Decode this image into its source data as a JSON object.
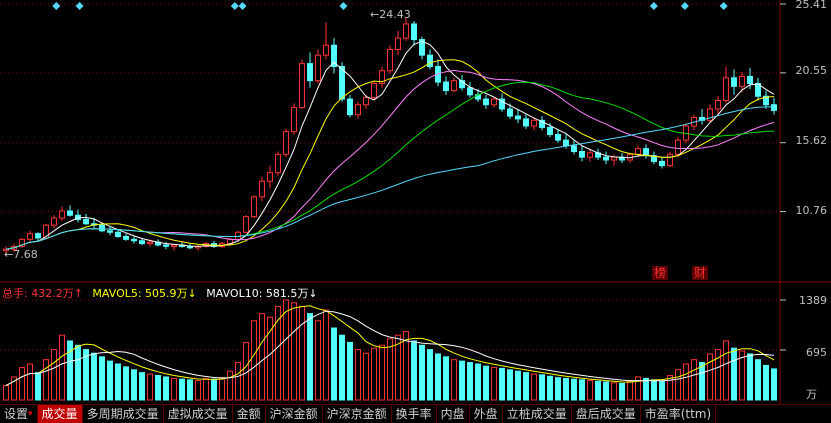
{
  "price_axis": [
    "25.41",
    "20.55",
    "15.62",
    "10.76"
  ],
  "volume_axis": [
    "1389",
    "695"
  ],
  "volume_unit": "万",
  "peak_label": "24.43",
  "low_label": "7.68",
  "volume_info": {
    "total": "总手: 432.2万↑",
    "mavol5": "MAVOL5: 505.9万↓",
    "mavol10": "MAVOL10: 581.5万↓"
  },
  "markers": [
    "榜",
    "财"
  ],
  "tabs": [
    "设置",
    "成交量",
    "多周期成交量",
    "虚拟成交量",
    "金额",
    "沪深金额",
    "沪深京金额",
    "换手率",
    "内盘",
    "外盘",
    "立桩成交量",
    "盘后成交量",
    "市盈率(ttm)"
  ],
  "active_tab": "成交量",
  "colors": {
    "up": "#ff3232",
    "down": "#54ffff",
    "ma5": "#ffffff",
    "ma10": "#ffff00",
    "ma20": "#ff80ff",
    "ma30": "#00e000",
    "ma60": "#54d8ff",
    "grid": "#800000"
  },
  "chart_data": {
    "type": "candlestick",
    "price_range": [
      7.2,
      25.41
    ],
    "volume_range": [
      0,
      1389
    ],
    "candles": [
      [
        8.0,
        8.3,
        7.7,
        8.1,
        200
      ],
      [
        8.1,
        8.5,
        7.9,
        8.3,
        320
      ],
      [
        8.3,
        8.9,
        8.2,
        8.8,
        450
      ],
      [
        8.8,
        9.4,
        8.6,
        9.2,
        500
      ],
      [
        9.2,
        9.3,
        8.7,
        8.9,
        380
      ],
      [
        8.9,
        9.9,
        8.8,
        9.8,
        560
      ],
      [
        9.8,
        10.5,
        9.6,
        10.3,
        700
      ],
      [
        10.3,
        11.1,
        10.1,
        10.8,
        900
      ],
      [
        10.8,
        11.2,
        10.4,
        10.5,
        820
      ],
      [
        10.5,
        10.9,
        10.0,
        10.2,
        760
      ],
      [
        10.2,
        10.6,
        9.8,
        9.9,
        700
      ],
      [
        9.9,
        10.3,
        9.6,
        9.8,
        650
      ],
      [
        9.8,
        10.0,
        9.3,
        9.4,
        600
      ],
      [
        9.4,
        9.7,
        9.1,
        9.3,
        540
      ],
      [
        9.3,
        9.5,
        8.9,
        9.0,
        500
      ],
      [
        9.0,
        9.2,
        8.7,
        8.8,
        460
      ],
      [
        8.8,
        9.0,
        8.5,
        8.7,
        420
      ],
      [
        8.7,
        8.9,
        8.4,
        8.5,
        380
      ],
      [
        8.5,
        8.8,
        8.3,
        8.6,
        360
      ],
      [
        8.6,
        8.8,
        8.3,
        8.4,
        340
      ],
      [
        8.4,
        8.6,
        8.1,
        8.3,
        320
      ],
      [
        8.3,
        8.5,
        8.0,
        8.4,
        300
      ],
      [
        8.4,
        8.6,
        8.2,
        8.3,
        290
      ],
      [
        8.3,
        8.5,
        8.1,
        8.2,
        280
      ],
      [
        8.2,
        8.4,
        8.0,
        8.3,
        270
      ],
      [
        8.3,
        8.6,
        8.2,
        8.5,
        300
      ],
      [
        8.5,
        8.7,
        8.2,
        8.3,
        290
      ],
      [
        8.3,
        8.6,
        8.2,
        8.5,
        310
      ],
      [
        8.5,
        8.9,
        8.4,
        8.8,
        400
      ],
      [
        8.8,
        9.4,
        8.7,
        9.3,
        520
      ],
      [
        9.3,
        10.5,
        9.2,
        10.4,
        800
      ],
      [
        10.4,
        11.9,
        10.3,
        11.8,
        1100
      ],
      [
        11.8,
        13.2,
        11.5,
        12.9,
        1200
      ],
      [
        12.9,
        14.0,
        12.4,
        13.5,
        1150
      ],
      [
        13.5,
        15.0,
        13.3,
        14.8,
        1300
      ],
      [
        14.8,
        16.6,
        14.6,
        16.4,
        1389
      ],
      [
        16.4,
        18.4,
        16.2,
        18.1,
        1350
      ],
      [
        18.1,
        21.5,
        18.0,
        21.2,
        1300
      ],
      [
        21.2,
        22.0,
        19.5,
        20.0,
        1200
      ],
      [
        20.0,
        22.2,
        19.8,
        21.8,
        1100
      ],
      [
        21.8,
        24.1,
        21.5,
        22.5,
        1250
      ],
      [
        22.5,
        23.0,
        20.5,
        21.0,
        1000
      ],
      [
        21.0,
        21.3,
        18.5,
        18.7,
        900
      ],
      [
        18.7,
        19.0,
        17.4,
        17.6,
        800
      ],
      [
        17.6,
        18.5,
        17.3,
        18.3,
        700
      ],
      [
        18.3,
        19.0,
        18.0,
        18.8,
        650
      ],
      [
        18.8,
        20.0,
        18.6,
        19.8,
        720
      ],
      [
        19.8,
        21.0,
        19.5,
        20.7,
        760
      ],
      [
        20.7,
        22.5,
        20.5,
        22.2,
        850
      ],
      [
        22.2,
        23.5,
        21.8,
        23.0,
        900
      ],
      [
        23.0,
        24.43,
        22.8,
        24.0,
        950
      ],
      [
        24.0,
        24.2,
        22.5,
        22.9,
        820
      ],
      [
        22.9,
        23.1,
        21.5,
        21.8,
        760
      ],
      [
        21.8,
        22.2,
        20.8,
        21.0,
        700
      ],
      [
        21.0,
        21.5,
        19.6,
        19.9,
        640
      ],
      [
        19.9,
        20.3,
        19.0,
        19.3,
        600
      ],
      [
        19.3,
        20.2,
        19.2,
        20.0,
        560
      ],
      [
        20.0,
        20.4,
        19.3,
        19.5,
        540
      ],
      [
        19.5,
        19.9,
        18.8,
        19.0,
        520
      ],
      [
        19.0,
        19.4,
        18.5,
        18.7,
        500
      ],
      [
        18.7,
        19.0,
        18.0,
        18.3,
        470
      ],
      [
        18.3,
        18.9,
        18.1,
        18.7,
        450
      ],
      [
        18.7,
        19.1,
        17.8,
        18.0,
        440
      ],
      [
        18.0,
        18.4,
        17.3,
        17.5,
        420
      ],
      [
        17.5,
        18.0,
        17.0,
        17.3,
        400
      ],
      [
        17.3,
        17.6,
        16.6,
        16.8,
        380
      ],
      [
        16.8,
        17.4,
        16.5,
        17.2,
        360
      ],
      [
        17.2,
        17.5,
        16.5,
        16.7,
        350
      ],
      [
        16.7,
        17.0,
        16.0,
        16.2,
        330
      ],
      [
        16.2,
        16.6,
        15.6,
        15.8,
        310
      ],
      [
        15.8,
        16.2,
        15.2,
        15.4,
        300
      ],
      [
        15.4,
        15.8,
        14.8,
        15.0,
        290
      ],
      [
        15.0,
        15.4,
        14.3,
        14.6,
        280
      ],
      [
        14.6,
        15.2,
        14.3,
        14.9,
        270
      ],
      [
        14.9,
        15.2,
        14.4,
        14.6,
        260
      ],
      [
        14.6,
        15.0,
        14.1,
        14.4,
        250
      ],
      [
        14.4,
        14.8,
        14.0,
        14.6,
        240
      ],
      [
        14.6,
        14.9,
        14.2,
        14.4,
        230
      ],
      [
        14.4,
        14.9,
        14.2,
        14.8,
        260
      ],
      [
        14.8,
        15.4,
        14.6,
        15.2,
        320
      ],
      [
        15.2,
        15.5,
        14.5,
        14.7,
        300
      ],
      [
        14.7,
        15.0,
        14.1,
        14.3,
        280
      ],
      [
        14.3,
        14.6,
        13.8,
        14.0,
        260
      ],
      [
        14.0,
        15.0,
        13.9,
        14.8,
        340
      ],
      [
        14.8,
        16.0,
        14.6,
        15.8,
        420
      ],
      [
        15.8,
        17.0,
        15.6,
        16.8,
        500
      ],
      [
        16.8,
        17.6,
        16.5,
        17.4,
        560
      ],
      [
        17.4,
        18.0,
        16.9,
        17.2,
        520
      ],
      [
        17.2,
        18.3,
        17.0,
        18.0,
        640
      ],
      [
        18.0,
        18.9,
        17.6,
        18.6,
        700
      ],
      [
        18.6,
        21.0,
        18.4,
        20.2,
        820
      ],
      [
        20.2,
        20.8,
        19.0,
        19.6,
        720
      ],
      [
        19.6,
        20.6,
        19.2,
        20.3,
        680
      ],
      [
        20.3,
        20.9,
        19.4,
        19.8,
        640
      ],
      [
        19.8,
        20.2,
        18.6,
        18.9,
        560
      ],
      [
        18.9,
        19.3,
        18.0,
        18.3,
        480
      ],
      [
        18.3,
        18.8,
        17.6,
        17.9,
        432
      ]
    ]
  }
}
